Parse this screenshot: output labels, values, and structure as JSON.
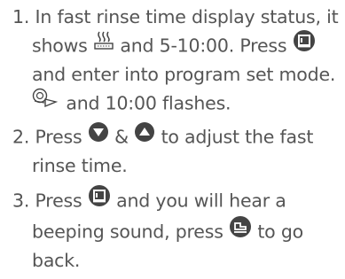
{
  "steps": [
    {
      "number": "1.",
      "lines": [
        "In fast rinse time display status, it",
        "shows",
        "and 5-10:00. Press",
        "and enter into program set mode.",
        "and 10:00 flashes."
      ]
    },
    {
      "number": "2.",
      "lines": [
        "Press",
        "&",
        "to adjust the fast",
        "rinse time."
      ]
    },
    {
      "number": "3.",
      "lines": [
        "Press",
        "and you will hear a",
        "beeping sound, press",
        "to go",
        "back."
      ]
    }
  ],
  "icons": {
    "rinse": "rinse-tray-icon",
    "program": "program-button-icon",
    "water": "water-drop-icon",
    "down": "down-arrow-button-icon",
    "up": "up-arrow-button-icon",
    "back": "back-button-icon"
  },
  "colors": {
    "text": "#555555",
    "icon": "#444444"
  }
}
